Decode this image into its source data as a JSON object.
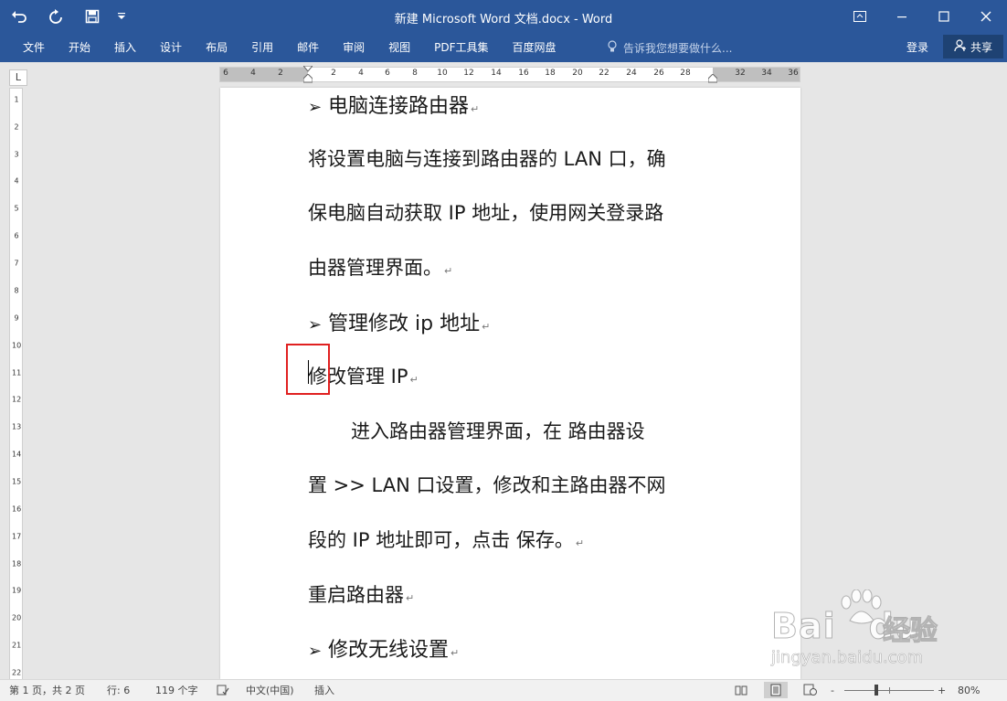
{
  "titlebar": {
    "title": "新建 Microsoft Word 文档.docx - Word",
    "qat": {
      "undo_icon": "undo-icon",
      "redo_icon": "redo-icon",
      "save_icon": "save-icon",
      "customize_icon": "customize-qat-icon"
    },
    "controls": {
      "ribbon_display_icon": "ribbon-display-icon",
      "minimize_icon": "minimize-icon",
      "maximize_icon": "maximize-icon",
      "close_icon": "close-icon"
    }
  },
  "ribbon": {
    "tabs": [
      "文件",
      "开始",
      "插入",
      "设计",
      "布局",
      "引用",
      "邮件",
      "审阅",
      "视图",
      "PDF工具集",
      "百度网盘"
    ],
    "tell_me": "告诉我您想要做什么...",
    "sign_in": "登录",
    "share": "共享"
  },
  "ruler": {
    "corner": "L",
    "h_numbers": [
      "6",
      "4",
      "2",
      "2",
      "4",
      "6",
      "8",
      "10",
      "12",
      "14",
      "16",
      "18",
      "20",
      "22",
      "24",
      "26",
      "28",
      "32",
      "34",
      "36"
    ],
    "v_numbers": [
      "1",
      "2",
      "3",
      "4",
      "5",
      "6",
      "7",
      "8",
      "9",
      "10",
      "11",
      "12",
      "13",
      "14",
      "15",
      "16",
      "17",
      "18",
      "19",
      "20",
      "21",
      "22"
    ]
  },
  "document": {
    "paragraphs": [
      {
        "text": "电脑连接路由器",
        "bullet": "➢",
        "heading": true
      },
      {
        "text": "将设置电脑与连接到路由器的 LAN 口，确",
        "bullet": "",
        "heading": false
      },
      {
        "text": "保电脑自动获取 IP 地址，使用网关登录路",
        "bullet": "",
        "heading": false
      },
      {
        "text": "由器管理界面。",
        "bullet": "",
        "heading": false,
        "mark": true
      },
      {
        "text": "管理修改 ip 地址",
        "bullet": "➢",
        "heading": true,
        "mark": true
      },
      {
        "text": "修改管理 IP",
        "bullet": "",
        "heading": false,
        "mark": true
      },
      {
        "text": "进入路由器管理界面，在  路由器设",
        "bullet": "",
        "heading": false,
        "indent": true
      },
      {
        "text": "置  >> LAN 口设置，修改和主路由器不网",
        "bullet": "",
        "heading": false
      },
      {
        "text": "段的 IP 地址即可，点击  保存。",
        "bullet": "",
        "heading": false,
        "mark": true
      },
      {
        "text": "重启路由器",
        "bullet": "",
        "heading": false,
        "mark": true
      },
      {
        "text": "修改无线设置",
        "bullet": "➢",
        "heading": true,
        "mark": true
      }
    ],
    "para_mark": "↵"
  },
  "watermark": {
    "brand": "Bai",
    "brand2": "du",
    "jingyan": "经验",
    "url": "jingyan.baidu.com"
  },
  "statusbar": {
    "page": "第 1 页，共 2 页",
    "line": "行: 6",
    "words": "119 个字",
    "language": "中文(中国)",
    "mode": "插入",
    "zoom": "80%",
    "zoom_value": 0.8,
    "zoom_minus": "-",
    "zoom_plus": "+"
  }
}
